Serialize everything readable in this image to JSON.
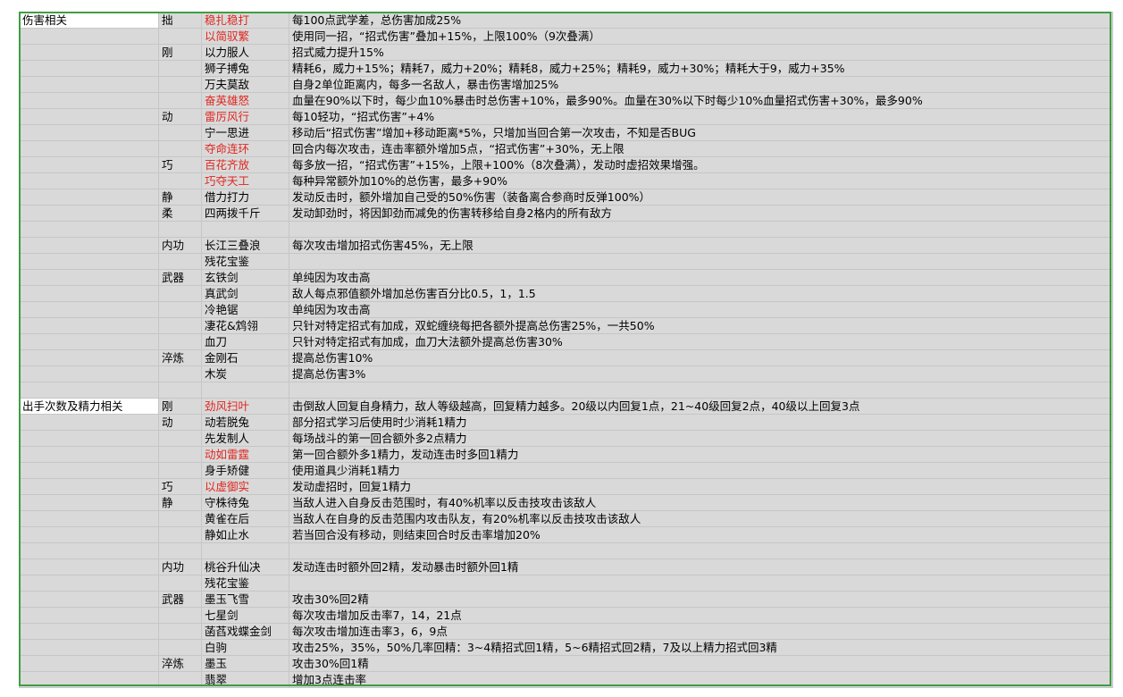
{
  "rows": [
    {
      "cat": "伤害相关",
      "sub": "拙",
      "name": "稳扎稳打",
      "red": true,
      "desc": "每100点武学差，总伤害加成25%"
    },
    {
      "cat": "",
      "sub": "",
      "name": "以简驭繁",
      "red": true,
      "desc": "使用同一招，“招式伤害”叠加+15%，上限100%（9次叠满）"
    },
    {
      "cat": "",
      "sub": "刚",
      "name": "以力服人",
      "red": false,
      "desc": "招式威力提升15%"
    },
    {
      "cat": "",
      "sub": "",
      "name": "狮子搏兔",
      "red": false,
      "desc": "精耗6，威力+15%；精耗7，威力+20%；精耗8，威力+25%；精耗9，威力+30%；精耗大于9，威力+35%"
    },
    {
      "cat": "",
      "sub": "",
      "name": "万夫莫敌",
      "red": false,
      "desc": "自身2单位距离内，每多一名敌人，暴击伤害增加25%"
    },
    {
      "cat": "",
      "sub": "",
      "name": "奋英雄怒",
      "red": true,
      "desc": "血量在90%以下时，每少血10%暴击时总伤害+10%，最多90%。血量在30%以下时每少10%血量招式伤害+30%，最多90%"
    },
    {
      "cat": "",
      "sub": "动",
      "name": "雷厉风行",
      "red": true,
      "desc": "每10轻功，“招式伤害”+4%"
    },
    {
      "cat": "",
      "sub": "",
      "name": "宁一思进",
      "red": false,
      "desc": "移动后“招式伤害”增加+移动距离*5%，只增加当回合第一次攻击，不知是否BUG"
    },
    {
      "cat": "",
      "sub": "",
      "name": "夺命连环",
      "red": true,
      "desc": "回合内每次攻击，连击率额外增加5点，“招式伤害”+30%，无上限"
    },
    {
      "cat": "",
      "sub": "巧",
      "name": "百花齐放",
      "red": true,
      "desc": "每多放一招，“招式伤害”+15%，上限+100%（8次叠满），发动时虚招效果增强。"
    },
    {
      "cat": "",
      "sub": "",
      "name": "巧夺天工",
      "red": true,
      "desc": "每种异常额外加10%的总伤害，最多+90%"
    },
    {
      "cat": "",
      "sub": "静",
      "name": "借力打力",
      "red": false,
      "desc": "发动反击时，额外增加自己受的50%伤害（装备离合参商时反弹100%）"
    },
    {
      "cat": "",
      "sub": "柔",
      "name": "四两拨千斤",
      "red": false,
      "desc": "发动卸劲时，将因卸劲而减免的伤害转移给自身2格内的所有敌方"
    },
    {
      "cat": "",
      "sub": "",
      "name": "",
      "red": false,
      "desc": ""
    },
    {
      "cat": "",
      "sub": "内功",
      "name": "长江三叠浪",
      "red": false,
      "desc": "每次攻击增加招式伤害45%，无上限"
    },
    {
      "cat": "",
      "sub": "",
      "name": "残花宝鉴",
      "red": false,
      "desc": ""
    },
    {
      "cat": "",
      "sub": "武器",
      "name": "玄铁剑",
      "red": false,
      "desc": "单纯因为攻击高"
    },
    {
      "cat": "",
      "sub": "",
      "name": "真武剑",
      "red": false,
      "desc": "敌人每点邪值额外增加总伤害百分比0.5，1，1.5"
    },
    {
      "cat": "",
      "sub": "",
      "name": "冷艳锯",
      "red": false,
      "desc": "单纯因为攻击高"
    },
    {
      "cat": "",
      "sub": "",
      "name": "凄花&鸩翎",
      "red": false,
      "desc": "只针对特定招式有加成，双蛇缠绕每把各额外提高总伤害25%，一共50%"
    },
    {
      "cat": "",
      "sub": "",
      "name": "血刀",
      "red": false,
      "desc": "只针对特定招式有加成，血刀大法额外提高总伤害30%"
    },
    {
      "cat": "",
      "sub": "淬炼",
      "name": "金刚石",
      "red": false,
      "desc": "提高总伤害10%"
    },
    {
      "cat": "",
      "sub": "",
      "name": "木炭",
      "red": false,
      "desc": "提高总伤害3%"
    },
    {
      "cat": "",
      "sub": "",
      "name": "",
      "red": false,
      "desc": ""
    },
    {
      "cat": "出手次数及精力相关",
      "sub": "刚",
      "name": "劲风扫叶",
      "red": true,
      "desc": "击倒敌人回复自身精力，敌人等级越高，回复精力越多。20级以内回复1点，21~40级回复2点，40级以上回复3点"
    },
    {
      "cat": "",
      "sub": "动",
      "name": "动若脱兔",
      "red": false,
      "desc": "部分招式学习后使用时少消耗1精力"
    },
    {
      "cat": "",
      "sub": "",
      "name": "先发制人",
      "red": false,
      "desc": "每场战斗的第一回合额外多2点精力"
    },
    {
      "cat": "",
      "sub": "",
      "name": "动如雷霆",
      "red": true,
      "desc": "第一回合额外多1精力，发动连击时多回1精力"
    },
    {
      "cat": "",
      "sub": "",
      "name": "身手矫健",
      "red": false,
      "desc": "使用道具少消耗1精力"
    },
    {
      "cat": "",
      "sub": "巧",
      "name": "以虚御实",
      "red": true,
      "desc": "发动虚招时，回复1精力"
    },
    {
      "cat": "",
      "sub": "静",
      "name": "守株待兔",
      "red": false,
      "desc": "当敌人进入自身反击范围时，有40%机率以反击技攻击该敌人"
    },
    {
      "cat": "",
      "sub": "",
      "name": "黄雀在后",
      "red": false,
      "desc": "当敌人在自身的反击范围内攻击队友，有20%机率以反击技攻击该敌人"
    },
    {
      "cat": "",
      "sub": "",
      "name": "静如止水",
      "red": false,
      "desc": "若当回合没有移动，则结束回合时反击率增加20%"
    },
    {
      "cat": "",
      "sub": "",
      "name": "",
      "red": false,
      "desc": ""
    },
    {
      "cat": "",
      "sub": "内功",
      "name": "桃谷升仙决",
      "red": false,
      "desc": "发动连击时额外回2精，发动暴击时额外回1精"
    },
    {
      "cat": "",
      "sub": "",
      "name": "残花宝鉴",
      "red": false,
      "desc": ""
    },
    {
      "cat": "",
      "sub": "武器",
      "name": "墨玉飞雪",
      "red": false,
      "desc": "攻击30%回2精"
    },
    {
      "cat": "",
      "sub": "",
      "name": "七星剑",
      "red": false,
      "desc": "每次攻击增加反击率7，14，21点"
    },
    {
      "cat": "",
      "sub": "",
      "name": "菡萏戏蝶金剑",
      "red": false,
      "desc": "每次攻击增加连击率3，6，9点"
    },
    {
      "cat": "",
      "sub": "",
      "name": "白驹",
      "red": false,
      "desc": "攻击25%，35%，50%几率回精：3~4精招式回1精，5~6精招式回2精，7及以上精力招式回3精"
    },
    {
      "cat": "",
      "sub": "淬炼",
      "name": "墨玉",
      "red": false,
      "desc": "攻击30%回1精"
    },
    {
      "cat": "",
      "sub": "",
      "name": "翡翠",
      "red": false,
      "desc": "增加3点连击率"
    }
  ]
}
